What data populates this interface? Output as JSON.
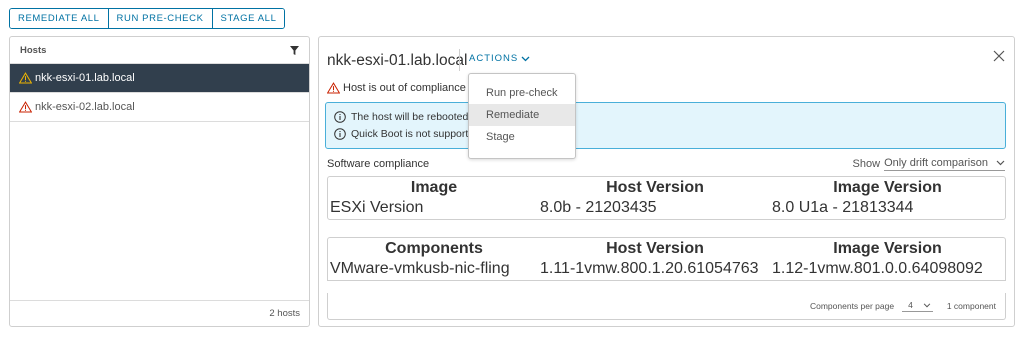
{
  "toolbar": {
    "remediate_all": "REMEDIATE ALL",
    "run_pre_check": "RUN PRE-CHECK",
    "stage_all": "STAGE ALL"
  },
  "hosts_panel": {
    "header": "Hosts",
    "items": [
      {
        "label": "nkk-esxi-01.lab.local",
        "status": "warning",
        "selected": true
      },
      {
        "label": "nkk-esxi-02.lab.local",
        "status": "warning",
        "selected": false
      }
    ],
    "footer_count": "2 hosts"
  },
  "detail": {
    "title": "nkk-esxi-01.lab.local",
    "actions_label": "ACTIONS",
    "compliance_status": "Host is out of compliance",
    "info_lines": [
      "The host will be rebooted during remediation.",
      "Quick Boot is not supported on the host."
    ],
    "software_compliance_label": "Software compliance",
    "show_label": "Show",
    "show_value": "Only drift comparison",
    "image_table": {
      "headers": [
        "Image",
        "Host Version",
        "Image Version"
      ],
      "rows": [
        [
          "ESXi Version",
          "8.0b - 21203435",
          "8.0 U1a - 21813344"
        ]
      ]
    },
    "components_table": {
      "headers": [
        "Components",
        "Host Version",
        "Image Version"
      ],
      "rows": [
        [
          "VMware-vmkusb-nic-fling",
          "1.11-1vmw.800.1.20.61054763",
          "1.12-1vmw.801.0.0.64098092"
        ]
      ]
    },
    "pager": {
      "per_page_label": "Components per page",
      "per_page_value": "4",
      "count": "1 component"
    }
  },
  "actions_menu": {
    "items": [
      "Run pre-check",
      "Remediate",
      "Stage"
    ]
  },
  "colors": {
    "accent": "#0072a3",
    "selected_bg": "#313f4d",
    "info_bg": "#e3f5fc",
    "info_border": "#49afd9",
    "warning": "#c92100"
  }
}
